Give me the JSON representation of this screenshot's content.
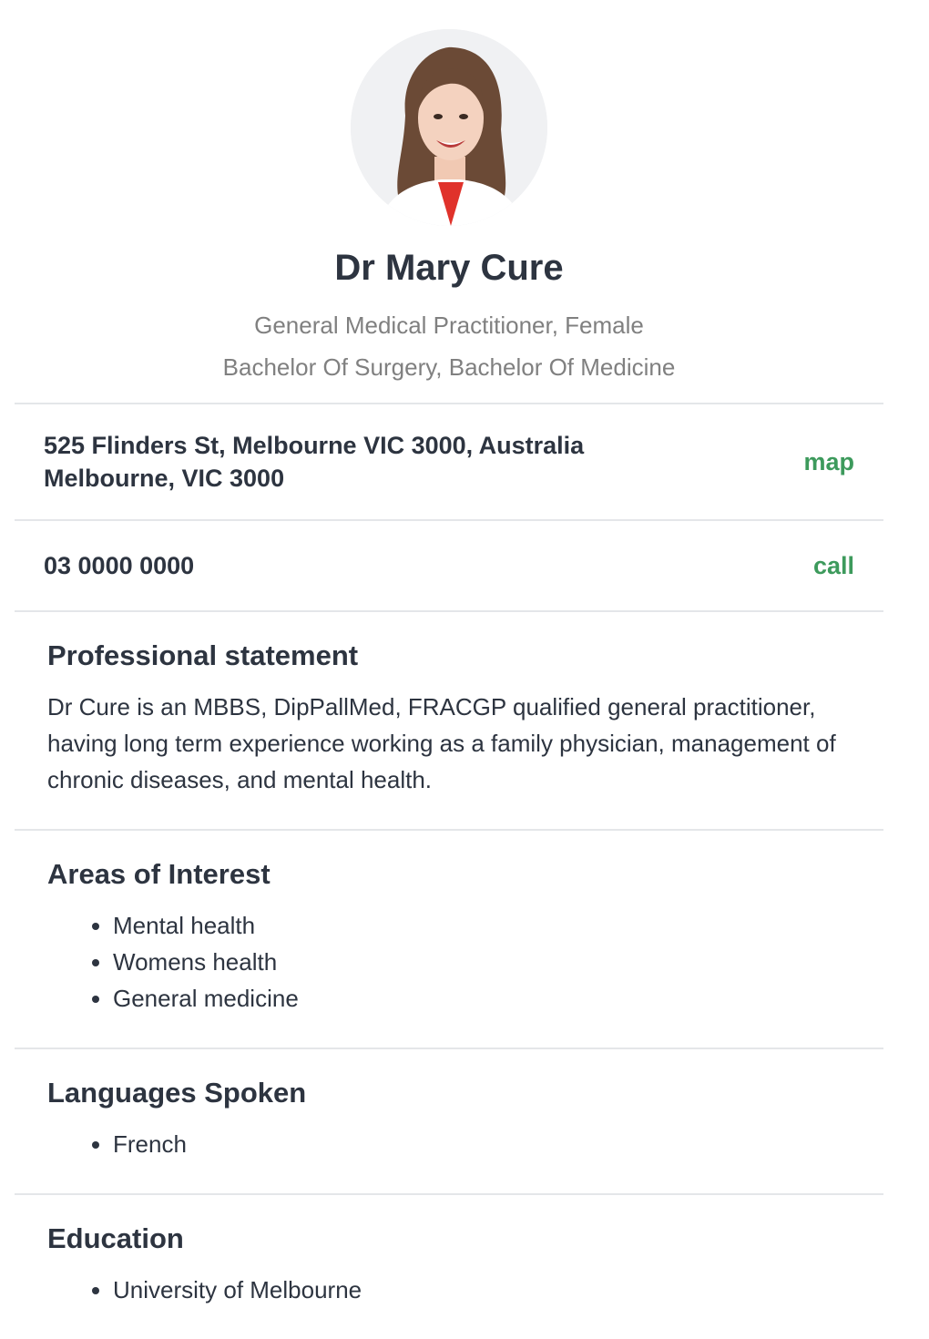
{
  "profile": {
    "name": "Dr Mary Cure",
    "subtitle_line1": "General Medical Practitioner, Female",
    "subtitle_line2": "Bachelor Of Surgery, Bachelor Of Medicine"
  },
  "address": {
    "line1": "525 Flinders St, Melbourne VIC 3000, Australia",
    "line2": "Melbourne, VIC 3000",
    "action_label": "map"
  },
  "phone": {
    "number": "03 0000 0000",
    "action_label": "call"
  },
  "professional_statement": {
    "title": "Professional statement",
    "body": "Dr Cure is an MBBS, DipPallMed, FRACGP qualified general practitioner, having long term experience working as a family physician, management of chronic diseases, and mental health."
  },
  "areas_of_interest": {
    "title": "Areas of Interest",
    "items": [
      "Mental health",
      "Womens health",
      "General medicine"
    ]
  },
  "languages": {
    "title": "Languages Spoken",
    "items": [
      "French"
    ]
  },
  "education": {
    "title": "Education",
    "items": [
      "University of Melbourne"
    ]
  },
  "colors": {
    "text": "#2d3440",
    "muted": "#808080",
    "accent": "#3d9a5c",
    "divider": "#e4e6e9"
  }
}
